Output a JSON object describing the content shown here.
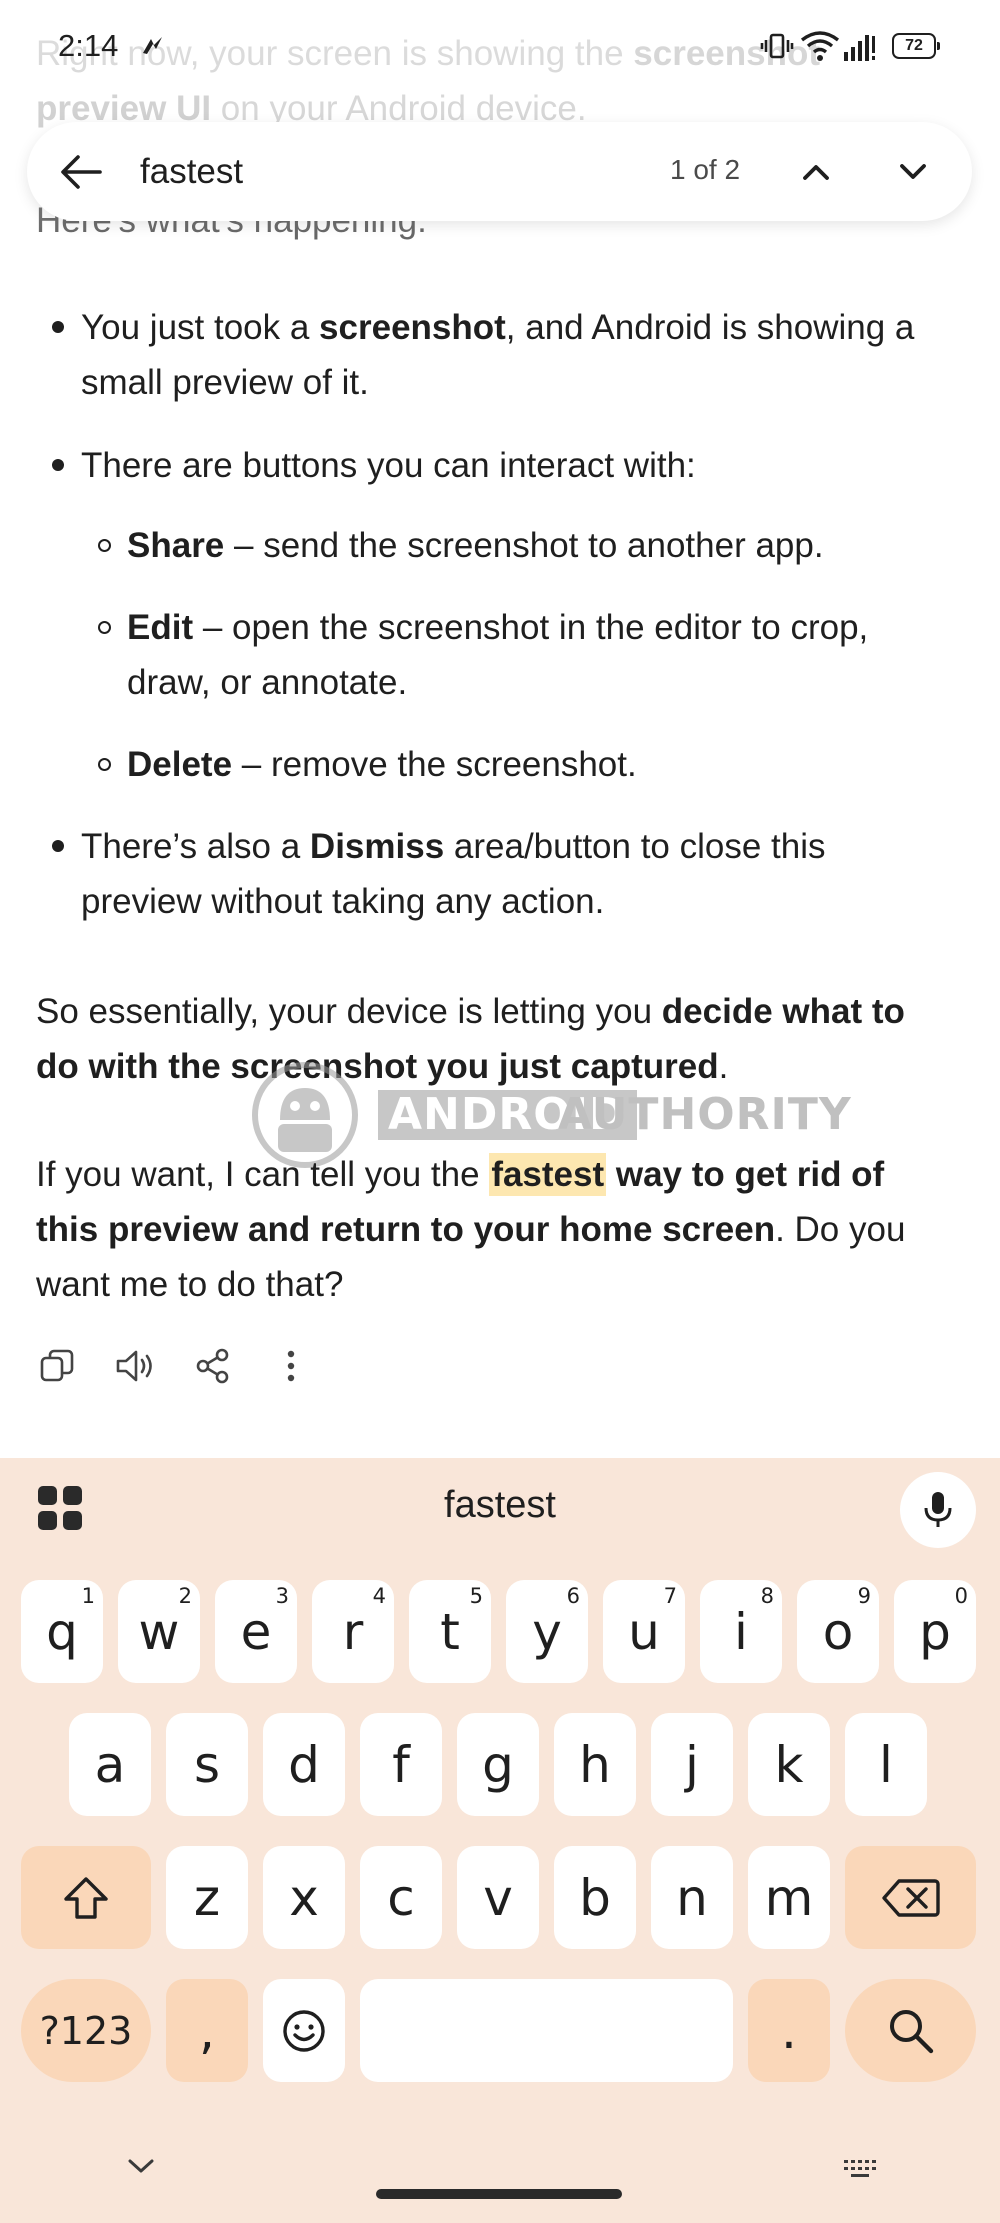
{
  "status_bar": {
    "time": "2:14",
    "battery": "72"
  },
  "find_bar": {
    "query": "fastest",
    "count": "1 of 2"
  },
  "content": {
    "intro_1_pre": "Right now, your screen is showing the ",
    "intro_1_bold": "screenshot",
    "intro_2_bold": "preview UI",
    "intro_2_post": " on your Android device.",
    "intro_3": "Here's what's happening:",
    "b1_pre": "You just took a ",
    "b1_bold": "screenshot",
    "b1_post1": ", and Android is showing a",
    "b1_post2": "small preview of it.",
    "b2": "There are buttons you can interact with:",
    "s1_bold": "Share",
    "s1_post": " – send the screenshot to another app.",
    "s2_bold": "Edit",
    "s2_post1": " – open the screenshot in the editor to crop,",
    "s2_post2": "draw, or annotate.",
    "s3_bold": "Delete",
    "s3_post": " – remove the screenshot.",
    "b3_pre": "There’s also a ",
    "b3_bold": "Dismiss",
    "b3_post1": " area/button to close this",
    "b3_post2": "preview without taking any action.",
    "p2_pre": "So essentially, your device is letting you ",
    "p2_bold1": "decide what to",
    "p2_bold2": "do with the screenshot you just captured",
    "p2_post": ".",
    "p3_pre": "If you want, I can tell you the ",
    "p3_hl": "fastest",
    "p3_bold1": " way to get rid of",
    "p3_bold2": "this preview and return to your home screen",
    "p3_post": ". Do you",
    "p3_line3": "want me to do that?"
  },
  "watermark": {
    "word1": "ANDROID",
    "word2": "AUTHORITY"
  },
  "keyboard": {
    "suggestion": "fastest",
    "row1": [
      {
        "k": "q",
        "h": "1"
      },
      {
        "k": "w",
        "h": "2"
      },
      {
        "k": "e",
        "h": "3"
      },
      {
        "k": "r",
        "h": "4"
      },
      {
        "k": "t",
        "h": "5"
      },
      {
        "k": "y",
        "h": "6"
      },
      {
        "k": "u",
        "h": "7"
      },
      {
        "k": "i",
        "h": "8"
      },
      {
        "k": "o",
        "h": "9"
      },
      {
        "k": "p",
        "h": "0"
      }
    ],
    "row2": [
      "a",
      "s",
      "d",
      "f",
      "g",
      "h",
      "j",
      "k",
      "l"
    ],
    "row3": [
      "z",
      "x",
      "c",
      "v",
      "b",
      "n",
      "m"
    ],
    "symbols": "?123",
    "comma": ",",
    "period": "."
  },
  "colors": {
    "highlight": "#fde7b0",
    "keyboard_bg": "#f9e6d9",
    "modifier_key": "#fad7b9"
  }
}
